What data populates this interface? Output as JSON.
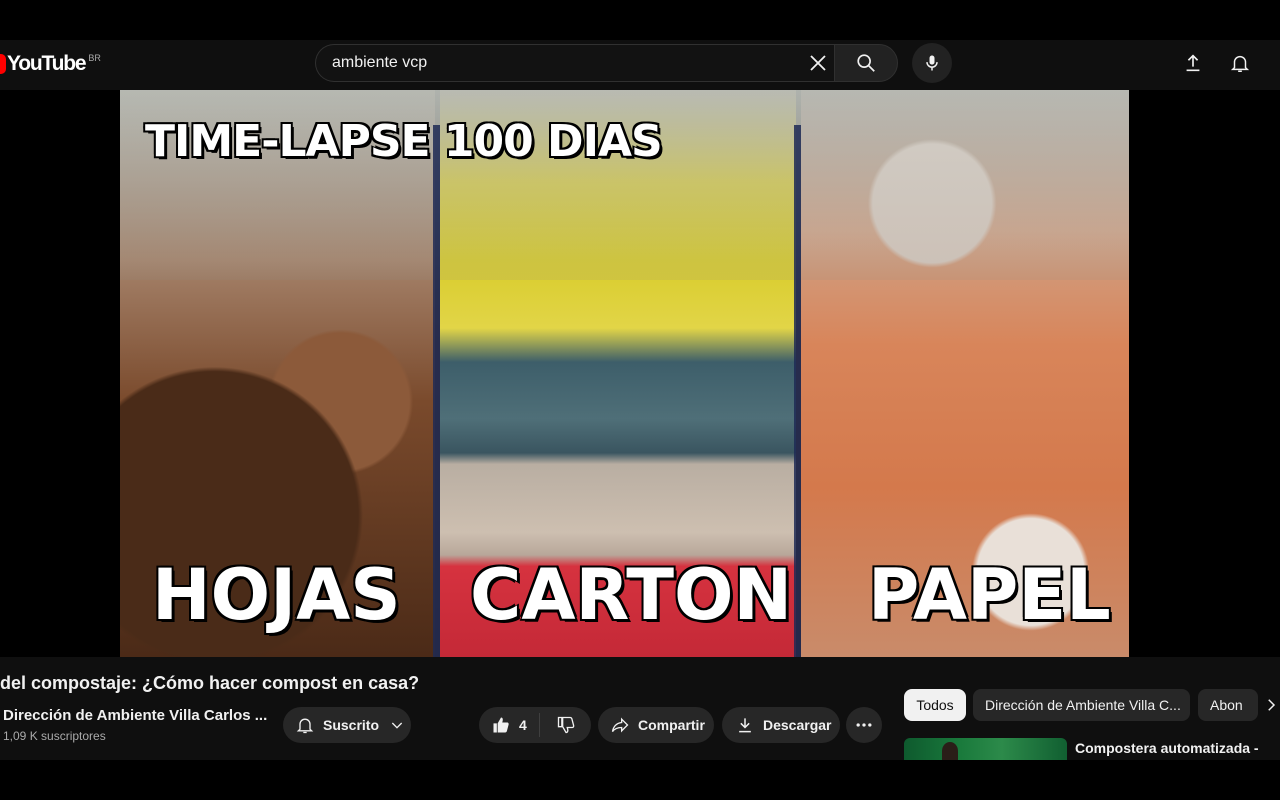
{
  "header": {
    "logo_text": "YouTube",
    "region": "BR",
    "search": {
      "value": "ambiente vcp"
    },
    "icons": [
      "clear-icon",
      "search-icon",
      "microphone-icon",
      "upload-icon",
      "bell-icon"
    ]
  },
  "video": {
    "overlay_title": "TIME-LAPSE 100 DIAS",
    "labels": [
      "HOJAS",
      "CARTON",
      "PAPEL"
    ]
  },
  "info": {
    "title": "del compostaje: ¿Cómo hacer compost en casa?",
    "channel_name": "Dirección de Ambiente Villa Carlos ...",
    "subscribers": "1,09 K suscriptores",
    "subscribe_label": "Suscrito",
    "like_count": "4",
    "share_label": "Compartir",
    "download_label": "Descargar"
  },
  "sidebar": {
    "chips": [
      "Todos",
      "Dirección de Ambiente Villa C...",
      "Abon"
    ],
    "recommendation_title": "Compostera automatizada -"
  },
  "colors": {
    "background": "#0f0f0f",
    "pill": "#272727",
    "brand_red": "#ff0000",
    "chip_selected": "#f1f1f1"
  }
}
